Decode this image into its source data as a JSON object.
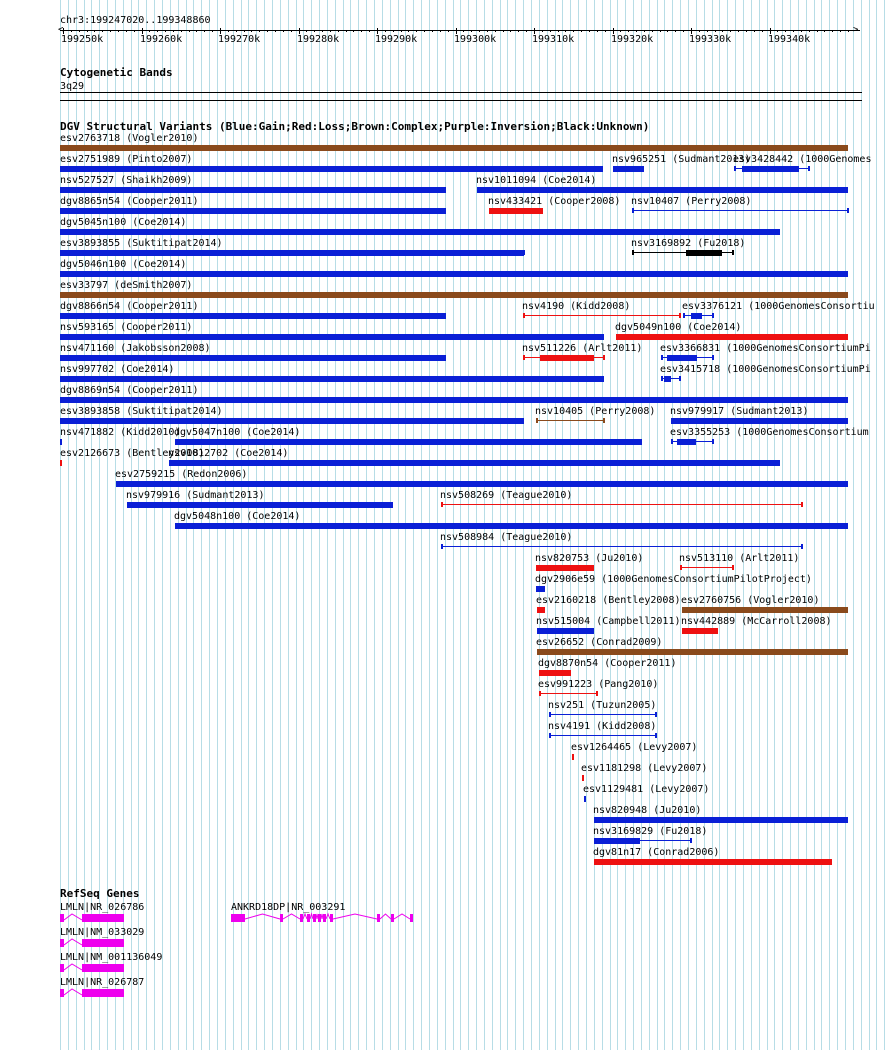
{
  "ruler": {
    "location": "chr3:199247020..199348860",
    "ticks": [
      {
        "label": "199250k",
        "pos": 199250
      },
      {
        "label": "199260k",
        "pos": 199260
      },
      {
        "label": "199270k",
        "pos": 199270
      },
      {
        "label": "199280k",
        "pos": 199280
      },
      {
        "label": "199290k",
        "pos": 199290
      },
      {
        "label": "199300k",
        "pos": 199300
      },
      {
        "label": "199310k",
        "pos": 199310
      },
      {
        "label": "199320k",
        "pos": 199320
      },
      {
        "label": "199330k",
        "pos": 199330
      },
      {
        "label": "199340k",
        "pos": 199340
      }
    ]
  },
  "cytoband": {
    "title": "Cytogenetic Bands",
    "band": "3q29"
  },
  "dgv": {
    "title": "DGV Structural Variants (Blue:Gain;Red:Loss;Brown:Complex;Purple:Inversion;Black:Unknown)",
    "colors": {
      "gain": "#0a1fd6",
      "loss": "#ee1111",
      "complex": "#8a4a1c",
      "inversion": "#800080",
      "unknown": "#000000"
    },
    "features": [
      {
        "id": "esv2763718 (Vogler2010)",
        "s": 199247.0,
        "e": 199350.0,
        "type": "complex",
        "track": 0
      },
      {
        "id": "esv2751989 (Pinto2007)",
        "s": 199247.0,
        "e": 199318.8,
        "type": "gain",
        "track": 1
      },
      {
        "id": "nsv965251 (Sudmant2013)",
        "s": 199320.0,
        "e": 199324.0,
        "type": "gain",
        "track": 1
      },
      {
        "id": "esv3428442 (1000Genomes",
        "s": 199335.5,
        "e": 199345.0,
        "type": "gain",
        "track": 1,
        "style": "pair",
        "blocks": [
          [
            199336.5,
            199343.7
          ]
        ]
      },
      {
        "id": "nsv527527 (Shaikh2009)",
        "s": 199247.0,
        "e": 199298.8,
        "type": "gain",
        "track": 2
      },
      {
        "id": "nsv1011094 (Coe2014)",
        "s": 199302.8,
        "e": 199350.0,
        "type": "gain",
        "track": 2
      },
      {
        "id": "dgv8865n54 (Cooper2011)",
        "s": 199247.0,
        "e": 199298.8,
        "type": "gain",
        "track": 3
      },
      {
        "id": "nsv433421 (Cooper2008)",
        "s": 199304.3,
        "e": 199311.1,
        "type": "loss",
        "track": 3
      },
      {
        "id": "nsv10407 (Perry2008)",
        "s": 199322.5,
        "e": 199350.0,
        "type": "gain",
        "track": 3,
        "style": "thin"
      },
      {
        "id": "dgv5045n100 (Coe2014)",
        "s": 199247.0,
        "e": 199341.4,
        "type": "gain",
        "track": 4
      },
      {
        "id": "esv3893855 (Suktitipat2014)",
        "s": 199247.0,
        "e": 199308.7,
        "type": "gain",
        "track": 5,
        "style": "pair",
        "blocks": [
          [
            199247.0,
            199308.7
          ]
        ]
      },
      {
        "id": "nsv3169892 (Fu2018)",
        "s": 199322.5,
        "e": 199335.4,
        "type": "unknown",
        "track": 5,
        "style": "pair",
        "blocks": [
          [
            199329.4,
            199333.9
          ]
        ]
      },
      {
        "id": "dgv5046n100 (Coe2014)",
        "s": 199247.0,
        "e": 199350.0,
        "type": "gain",
        "track": 6
      },
      {
        "id": "esv33797 (deSmith2007)",
        "s": 199247.0,
        "e": 199350.0,
        "type": "complex",
        "track": 7
      },
      {
        "id": "dgv8866n54 (Cooper2011)",
        "s": 199247.0,
        "e": 199298.8,
        "type": "gain",
        "track": 8
      },
      {
        "id": "nsv4190 (Kidd2008)",
        "s": 199308.6,
        "e": 199328.6,
        "type": "loss",
        "track": 8,
        "style": "thin"
      },
      {
        "id": "esv3376121 (1000GenomesConsortiu",
        "s": 199329.0,
        "e": 199332.8,
        "type": "gain",
        "track": 8,
        "style": "pair",
        "blocks": [
          [
            199330.0,
            199331.4
          ]
        ]
      },
      {
        "id": "nsv593165 (Cooper2011)",
        "s": 199247.0,
        "e": 199318.9,
        "type": "gain",
        "track": 9
      },
      {
        "id": "dgv5049n100 (Coe2014)",
        "s": 199320.4,
        "e": 199350.0,
        "type": "loss",
        "track": 9
      },
      {
        "id": "nsv471160 (Jakobsson2008)",
        "s": 199247.0,
        "e": 199298.8,
        "type": "gain",
        "track": 10
      },
      {
        "id": "nsv511226 (Arlt2011)",
        "s": 199308.6,
        "e": 199318.9,
        "type": "loss",
        "track": 10,
        "style": "pair",
        "blocks": [
          [
            199310.8,
            199317.7
          ]
        ]
      },
      {
        "id": "esv3366831 (1000GenomesConsortiumPi",
        "s": 199326.2,
        "e": 199332.8,
        "type": "gain",
        "track": 10,
        "style": "pair",
        "blocks": [
          [
            199327.0,
            199330.8
          ]
        ]
      },
      {
        "id": "nsv997702 (Coe2014)",
        "s": 199247.0,
        "e": 199318.9,
        "type": "gain",
        "track": 11
      },
      {
        "id": "esv3415718 (1000GenomesConsortiumPi",
        "s": 199326.2,
        "e": 199328.6,
        "type": "gain",
        "track": 11,
        "style": "pair",
        "blocks": [
          [
            199326.6,
            199327.5
          ]
        ]
      },
      {
        "id": "dgv8869n54 (Cooper2011)",
        "s": 199247.0,
        "e": 199350.0,
        "type": "gain",
        "track": 12
      },
      {
        "id": "esv3893858 (Suktitipat2014)",
        "s": 199247.0,
        "e": 199308.7,
        "type": "gain",
        "track": 13
      },
      {
        "id": "nsv10405 (Perry2008)",
        "s": 199310.2,
        "e": 199318.9,
        "type": "complex",
        "track": 13,
        "style": "thin"
      },
      {
        "id": "nsv979917 (Sudmant2013)",
        "s": 199327.4,
        "e": 199350.0,
        "type": "gain",
        "track": 13
      },
      {
        "id": "nsv471882 (Kidd2010)",
        "s": 199247.7,
        "e": 199248.0,
        "type": "gain",
        "track": 14
      },
      {
        "id": "dgv5047n100 (Coe2014)",
        "s": 199264.3,
        "e": 199323.7,
        "type": "gain",
        "track": 14
      },
      {
        "id": "esv3355253 (1000GenomesConsortium",
        "s": 199327.4,
        "e": 199332.8,
        "type": "gain",
        "track": 14,
        "style": "pair",
        "blocks": [
          [
            199328.2,
            199330.6
          ]
        ]
      },
      {
        "id": "esv2126673 (Bentley2008)",
        "s": 199249.2,
        "e": 199249.8,
        "type": "loss",
        "track": 15
      },
      {
        "id": "nsv1012702 (Coe2014)",
        "s": 199263.5,
        "e": 199341.4,
        "type": "gain",
        "track": 15
      },
      {
        "id": "esv2759215 (Redon2006)",
        "s": 199256.7,
        "e": 199350.0,
        "type": "gain",
        "track": 16
      },
      {
        "id": "nsv979916 (Sudmant2013)",
        "s": 199258.1,
        "e": 199292.1,
        "type": "gain",
        "track": 17
      },
      {
        "id": "nsv508269 (Teague2010)",
        "s": 199298.2,
        "e": 199344.2,
        "type": "loss",
        "track": 17,
        "style": "thin"
      },
      {
        "id": "dgv5048n100 (Coe2014)",
        "s": 199264.3,
        "e": 199350.0,
        "type": "gain",
        "track": 18
      },
      {
        "id": "nsv508984 (Teague2010)",
        "s": 199298.2,
        "e": 199344.2,
        "type": "gain",
        "track": 19,
        "style": "thin"
      },
      {
        "id": "nsv820753 (Ju2010)",
        "s": 199310.2,
        "e": 199317.7,
        "type": "loss",
        "track": 20
      },
      {
        "id": "nsv513110 (Arlt2011)",
        "s": 199328.6,
        "e": 199335.4,
        "type": "loss",
        "track": 20,
        "style": "thin"
      },
      {
        "id": "dgv2906e59 (1000GenomesConsortiumPilotProject)",
        "s": 199310.2,
        "e": 199311.4,
        "type": "gain",
        "track": 21
      },
      {
        "id": "esv2160218 (Bentley2008)",
        "s": 199310.4,
        "e": 199311.4,
        "type": "loss",
        "track": 22
      },
      {
        "id": "esv2760756 (Vogler2010)",
        "s": 199328.9,
        "e": 199350.0,
        "type": "complex",
        "track": 22
      },
      {
        "id": "nsv515004 (Campbell2011)",
        "s": 199310.4,
        "e": 199317.7,
        "type": "gain",
        "track": 23
      },
      {
        "id": "nsv442889 (McCarroll2008)",
        "s": 199328.9,
        "e": 199333.4,
        "type": "loss",
        "track": 23
      },
      {
        "id": "esv26652 (Conrad2009)",
        "s": 199310.4,
        "e": 199350.0,
        "type": "complex",
        "track": 24
      },
      {
        "id": "dgv8870n54 (Cooper2011)",
        "s": 199310.6,
        "e": 199314.7,
        "type": "loss",
        "track": 25
      },
      {
        "id": "esv991223 (Pang2010)",
        "s": 199310.7,
        "e": 199318.0,
        "type": "loss",
        "track": 26,
        "style": "thin"
      },
      {
        "id": "nsv251 (Tuzun2005)",
        "s": 199311.9,
        "e": 199325.5,
        "type": "gain",
        "track": 27,
        "style": "thin"
      },
      {
        "id": "nsv4191 (Kidd2008)",
        "s": 199311.9,
        "e": 199325.5,
        "type": "gain",
        "track": 28,
        "style": "thin"
      },
      {
        "id": "esv1264465 (Levy2007)",
        "s": 199314.8,
        "e": 199315.1,
        "type": "loss",
        "track": 29
      },
      {
        "id": "esv1181298 (Levy2007)",
        "s": 199316.1,
        "e": 199316.3,
        "type": "loss",
        "track": 30
      },
      {
        "id": "esv1129481 (Levy2007)",
        "s": 199316.4,
        "e": 199316.6,
        "type": "gain",
        "track": 31
      },
      {
        "id": "nsv820948 (Ju2010)",
        "s": 199317.7,
        "e": 199350.0,
        "type": "gain",
        "track": 32
      },
      {
        "id": "nsv3169829 (Fu2018)",
        "s": 199317.7,
        "e": 199330.0,
        "type": "gain",
        "track": 33,
        "style": "pair",
        "blocks": [
          [
            199317.7,
            199323.5
          ]
        ]
      },
      {
        "id": "dgv81n17 (Conrad2006)",
        "s": 199317.7,
        "e": 199347.9,
        "type": "loss",
        "track": 34
      }
    ]
  },
  "refseq": {
    "title": "RefSeq Genes",
    "color": "#ee00ee",
    "genes": [
      {
        "label": "LMLN|NR_026786",
        "row": 0
      },
      {
        "label": "LMLN|NM_033029",
        "row": 1
      },
      {
        "label": "LMLN|NM_001136049",
        "row": 2
      },
      {
        "label": "LMLN|NR_026787",
        "row": 3
      },
      {
        "label": "ANKRD18DP|NR_003291",
        "row": 0
      }
    ]
  }
}
